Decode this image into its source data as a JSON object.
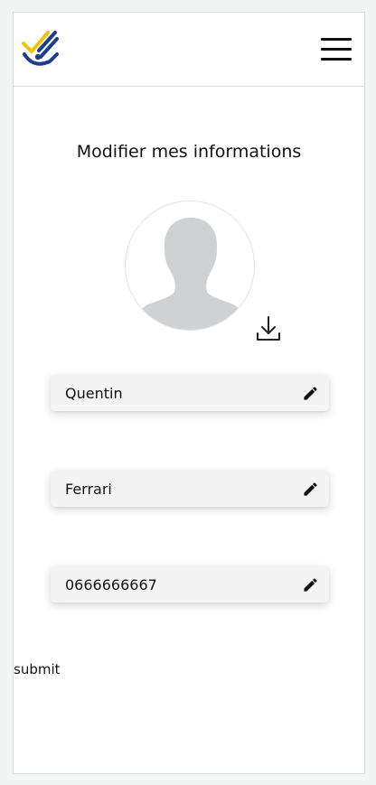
{
  "header": {
    "logo_icon": "checkmark-logo-icon",
    "menu_icon": "hamburger-menu-icon"
  },
  "profile": {
    "title": "Modifier mes informations",
    "avatar_icon": "default-avatar-silhouette",
    "download_icon": "download-icon"
  },
  "fields": [
    {
      "value": "Quentin",
      "icon": "pencil-edit-icon"
    },
    {
      "value": "Ferrari",
      "icon": "pencil-edit-icon"
    },
    {
      "value": "0666666667",
      "icon": "pencil-edit-icon"
    }
  ],
  "submit_label": "submit",
  "colors": {
    "logo_yellow": "#f2c200",
    "logo_blue": "#1f3d8f",
    "field_bg": "#f4f4f4",
    "avatar_grey": "#d0d1d3"
  }
}
